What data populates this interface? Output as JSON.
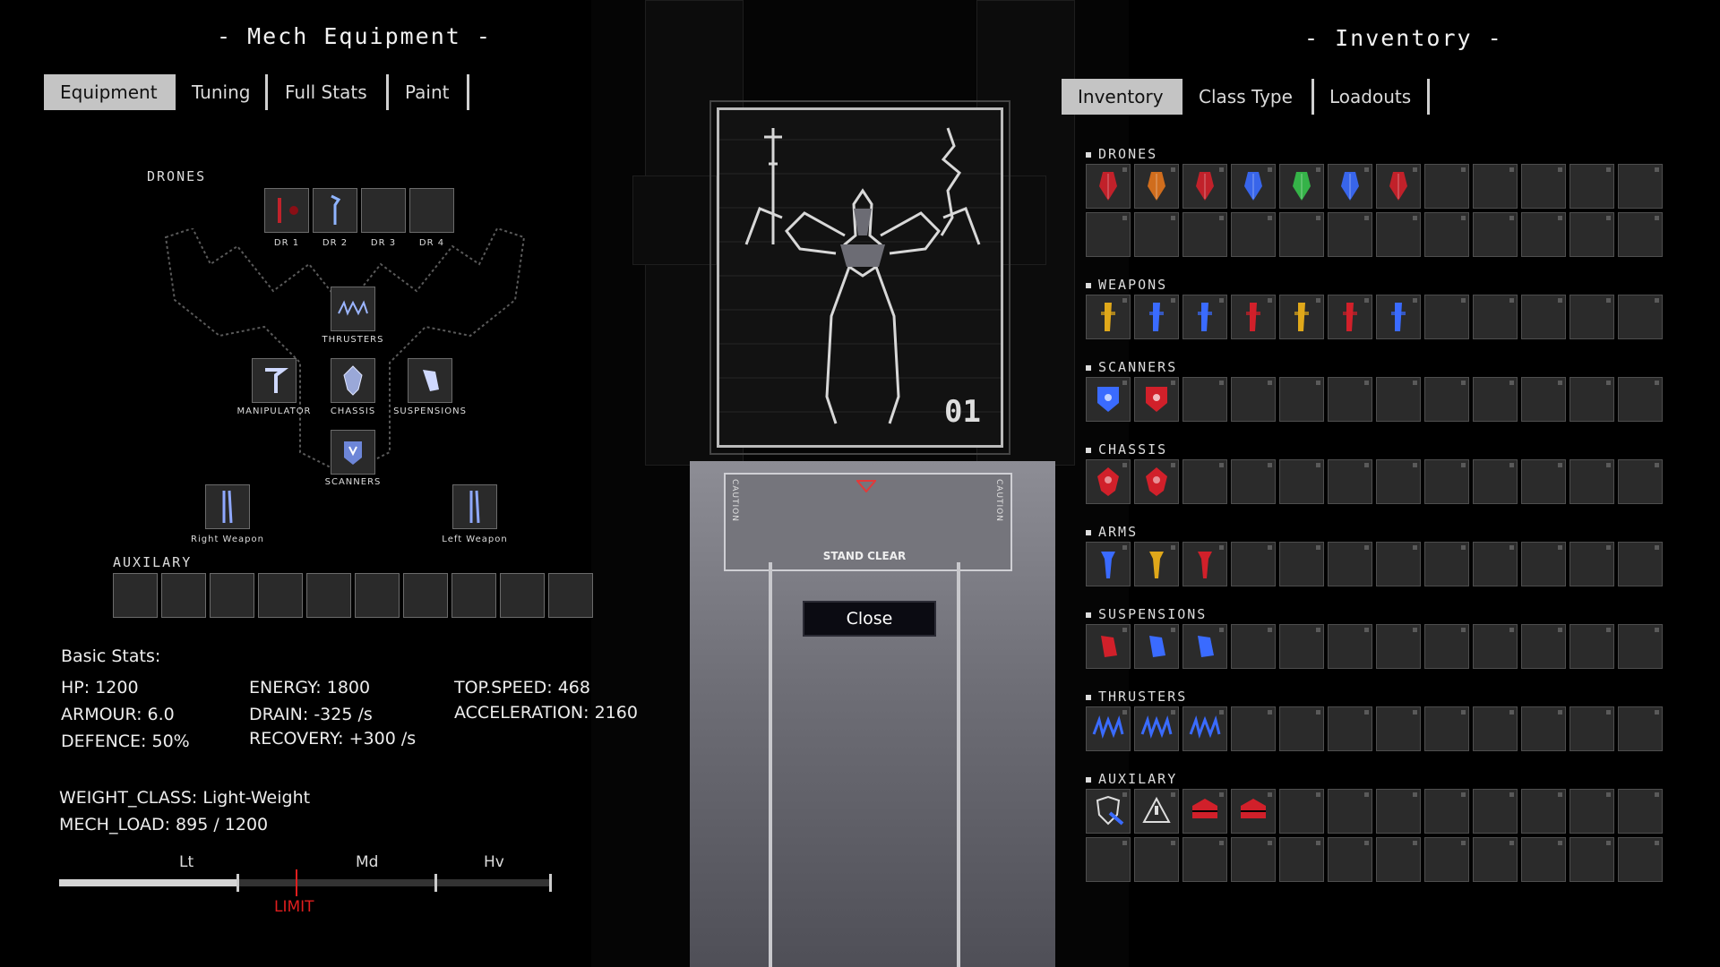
{
  "left_panel": {
    "title": "- Mech Equipment -",
    "tabs": [
      {
        "label": "Equipment",
        "active": true
      },
      {
        "label": "Tuning",
        "active": false
      },
      {
        "label": "Full Stats",
        "active": false
      },
      {
        "label": "Paint",
        "active": false
      }
    ],
    "drones_label": "DRONES",
    "drone_slots": [
      "DR 1",
      "DR 2",
      "DR 3",
      "DR 4"
    ],
    "slots": {
      "thrusters": "THRUSTERS",
      "manipulator": "MANIPULATOR",
      "chassis": "CHASSIS",
      "suspensions": "SUSPENSIONS",
      "scanners": "SCANNERS",
      "right_weapon": "Right Weapon",
      "left_weapon": "Left Weapon"
    },
    "auxilary_label": "AUXILARY",
    "stats": {
      "heading": "Basic Stats:",
      "hp": "HP: 1200",
      "armour": "ARMOUR: 6.0",
      "defence": "DEFENCE: 50%",
      "energy": "ENERGY: 1800",
      "drain": "DRAIN: -325 /s",
      "recovery": "RECOVERY: +300 /s",
      "top_speed": "TOP.SPEED: 468",
      "acceleration": "ACCELERATION: 2160",
      "weight_class": "WEIGHT_CLASS: Light-Weight",
      "mech_load": "MECH_LOAD: 895 / 1200"
    },
    "weight_bar": {
      "labels": [
        "Lt",
        "Md",
        "Hv"
      ],
      "limit_label": "LIMIT",
      "load": 895,
      "max": 1200
    }
  },
  "center": {
    "close_label": "Close",
    "stand_clear": "STAND CLEAR",
    "caution": "CAUTION",
    "bay_number": "01"
  },
  "right_panel": {
    "title": "- Inventory -",
    "tabs": [
      {
        "label": "Inventory",
        "active": true
      },
      {
        "label": "Class Type",
        "active": false
      },
      {
        "label": "Loadouts",
        "active": false
      }
    ],
    "sections": [
      {
        "label": "DRONES",
        "rows": 2,
        "items": [
          "red-drone",
          "orange-drone",
          "red-drone",
          "blue-drone",
          "green-drone",
          "blue-drone",
          "red-drone"
        ]
      },
      {
        "label": "WEAPONS",
        "rows": 1,
        "items": [
          "yellow-weapon",
          "blue-weapon",
          "blue-weapon",
          "red-weapon",
          "yellow-weapon",
          "red-weapon",
          "blue-weapon"
        ]
      },
      {
        "label": "SCANNERS",
        "rows": 1,
        "items": [
          "blue-scanner",
          "red-scanner"
        ]
      },
      {
        "label": "CHASSIS",
        "rows": 1,
        "items": [
          "red-chassis",
          "red-chassis"
        ]
      },
      {
        "label": "ARMS",
        "rows": 1,
        "items": [
          "blue-arm",
          "yellow-arm",
          "red-arm"
        ]
      },
      {
        "label": "SUSPENSIONS",
        "rows": 1,
        "items": [
          "red-suspension",
          "blue-suspension",
          "blue-suspension"
        ]
      },
      {
        "label": "THRUSTERS",
        "rows": 1,
        "items": [
          "blue-thruster",
          "blue-thruster",
          "blue-thruster"
        ]
      },
      {
        "label": "AUXILARY",
        "rows": 2,
        "items": [
          "shield-aux",
          "warning-aux",
          "red-aux",
          "red-aux"
        ]
      }
    ]
  },
  "colors": {
    "red": "#d1202a",
    "blue": "#3a6bff",
    "yellow": "#e0a81a",
    "green": "#36c24b",
    "orange": "#e2741c",
    "limit": "#e01e1e"
  }
}
